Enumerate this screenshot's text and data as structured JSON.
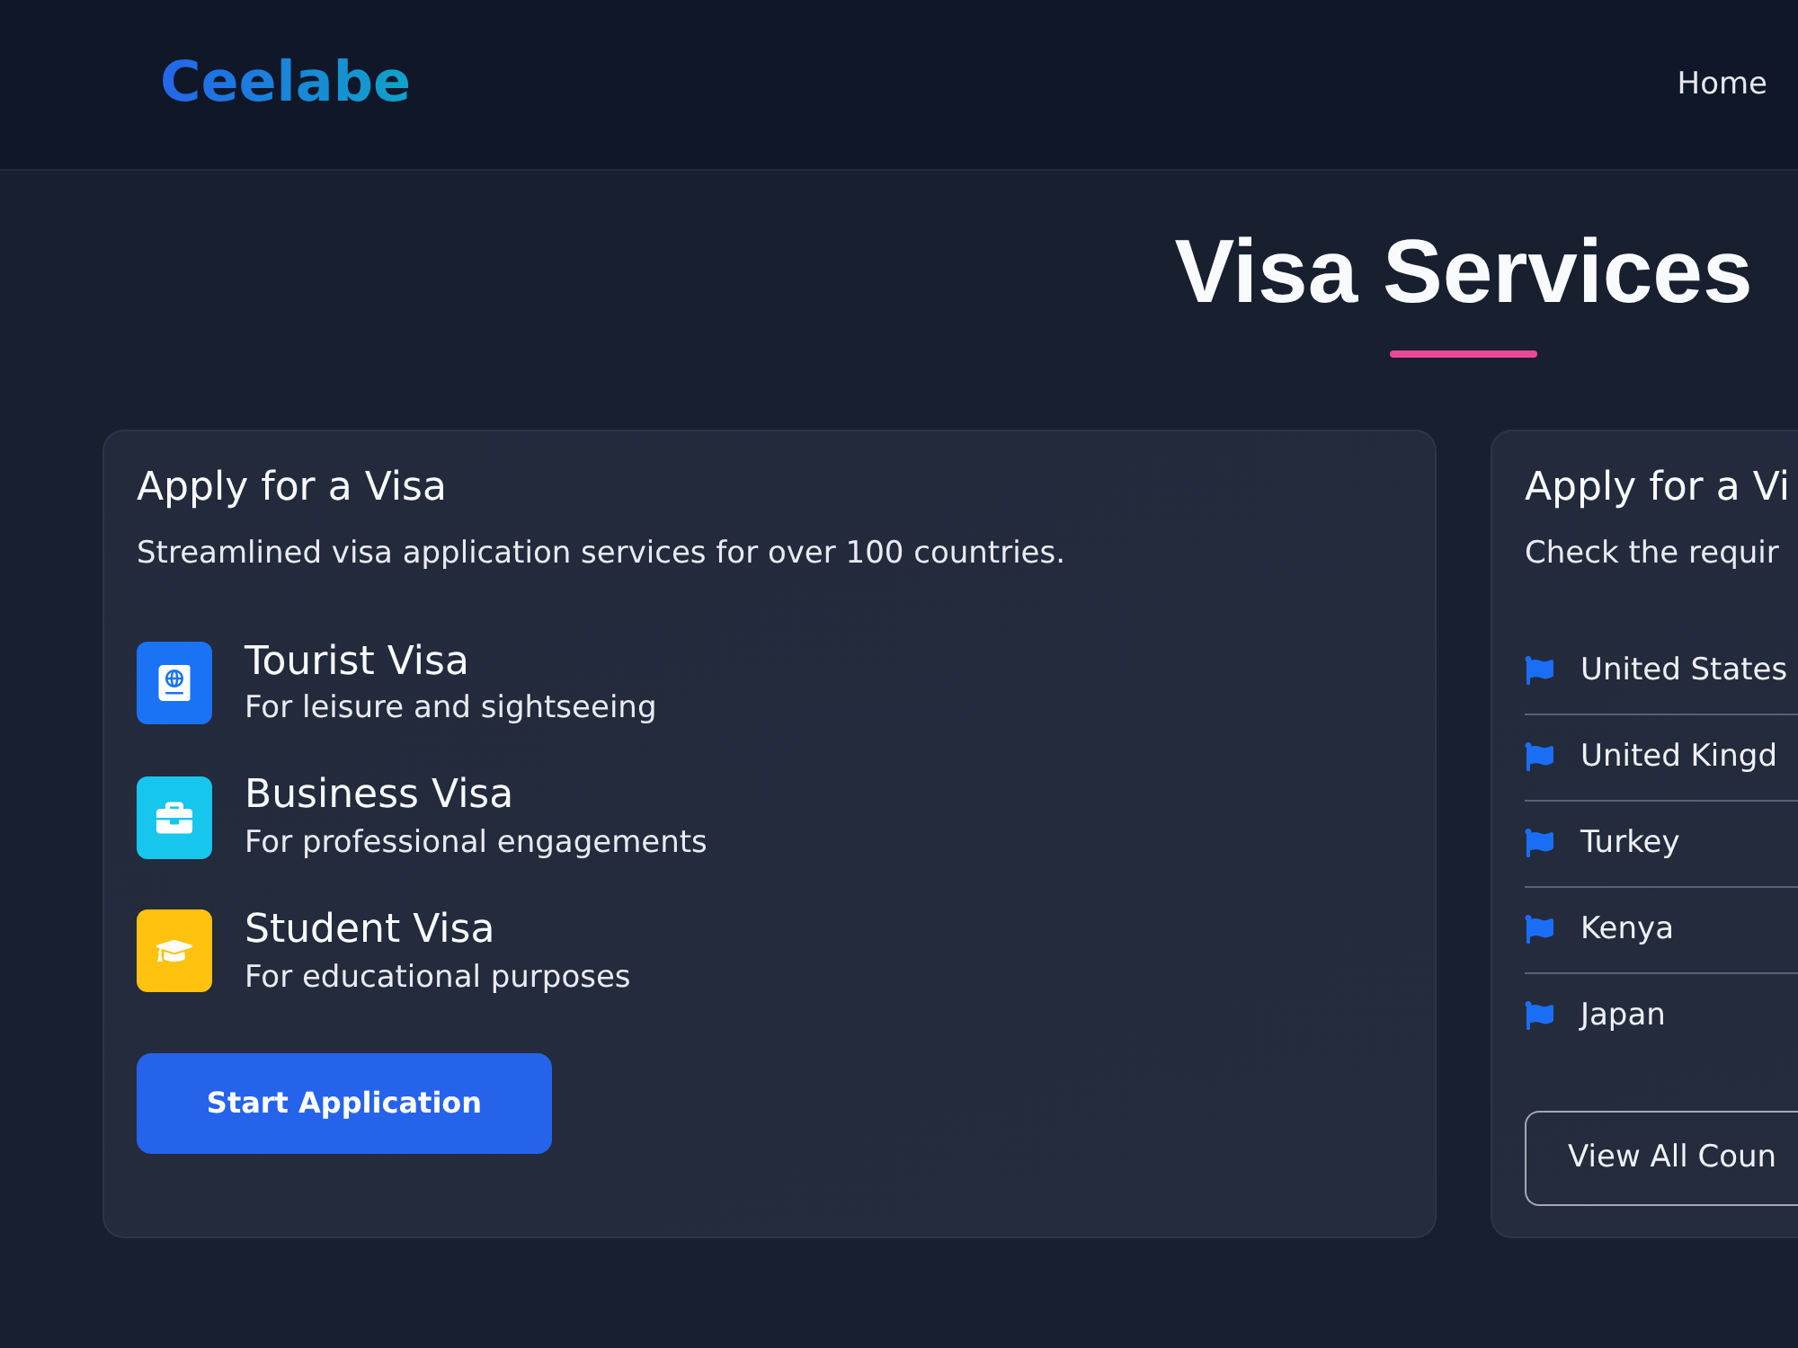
{
  "header": {
    "logo": "Ceelabe",
    "nav": [
      "Home"
    ]
  },
  "page_title": "Visa Services",
  "services_card": {
    "title": "Apply for a Visa",
    "description": "Streamlined visa application services for over 100 countries.",
    "visa_types": [
      {
        "kind": "tourist",
        "name": "Tourist Visa",
        "description": "For leisure and sightseeing",
        "color": "#1a73f5"
      },
      {
        "kind": "business",
        "name": "Business Visa",
        "description": "For professional engagements",
        "color": "#16c6ec"
      },
      {
        "kind": "student",
        "name": "Student Visa",
        "description": "For educational purposes",
        "color": "#ffc20e"
      }
    ],
    "button": "Start Application"
  },
  "countries_card": {
    "title": "Apply for a Vi",
    "description": "Check the requir",
    "countries": [
      "United States",
      "United Kingd",
      "Turkey",
      "Kenya",
      "Japan"
    ],
    "button": "View All Coun"
  }
}
